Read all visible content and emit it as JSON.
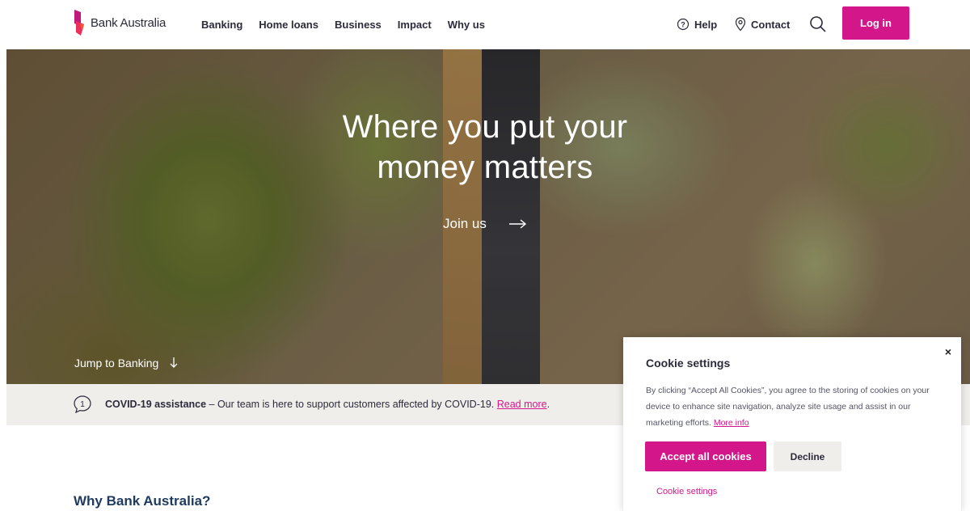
{
  "brand": {
    "name": "Bank Australia",
    "accent_color": "#d3178a"
  },
  "nav": {
    "items": [
      {
        "label": "Banking"
      },
      {
        "label": "Home loans"
      },
      {
        "label": "Business"
      },
      {
        "label": "Impact"
      },
      {
        "label": "Why us"
      }
    ]
  },
  "utility": {
    "help_label": "Help",
    "help_icon": "question-circle-icon",
    "contact_label": "Contact",
    "contact_icon": "location-pin-icon",
    "search_icon": "search-icon",
    "login_label": "Log in"
  },
  "hero": {
    "title_line1": "Where you put your",
    "title_line2": "money matters",
    "cta_label": "Join us",
    "cta_icon": "arrow-right-icon",
    "jump_label": "Jump to Banking",
    "jump_icon": "arrow-down-icon"
  },
  "notice": {
    "icon": "chat-bubble-info-icon",
    "title": "COVID-19 assistance",
    "text": " – Our team is here to support customers affected by COVID-19. ",
    "link": "Read more",
    "after": "."
  },
  "section": {
    "heading": "Why Bank Australia?"
  },
  "cookie": {
    "title": "Cookie settings",
    "close": "×",
    "body": "By clicking “Accept All Cookies”, you agree to the storing of cookies on your device to enhance site navigation, analyze site usage and assist in our marketing efforts. ",
    "more_link": "More info",
    "accept_label": "Accept all cookies",
    "decline_label": "Decline",
    "settings_link": "Cookie settings"
  }
}
